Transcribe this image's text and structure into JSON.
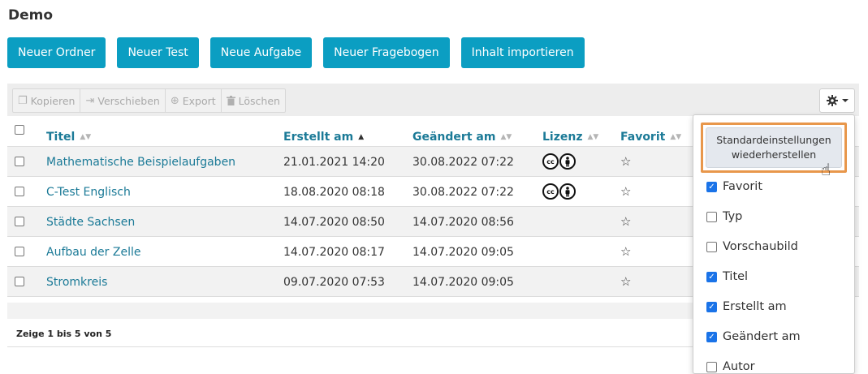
{
  "page": {
    "title": "Demo"
  },
  "actions": [
    "Neuer Ordner",
    "Neuer Test",
    "Neue Aufgabe",
    "Neuer Fragebogen",
    "Inhalt importieren"
  ],
  "toolbar": {
    "copy": "Kopieren",
    "move": "Verschieben",
    "export": "Export",
    "delete": "Löschen",
    "copy_icon": "copy-icon",
    "move_icon": "move-icon",
    "export_icon": "download-icon",
    "delete_icon": "trash-icon",
    "settings_icon": "gear-icon"
  },
  "table": {
    "headers": {
      "title": "Titel",
      "created": "Erstellt am",
      "modified": "Geändert am",
      "license": "Lizenz",
      "favorite": "Favorit"
    },
    "sorted_column": "created",
    "rows": [
      {
        "title": "Mathematische Beispielaufgaben",
        "created": "21.01.2021 14:20",
        "modified": "30.08.2022 07:22",
        "license": true
      },
      {
        "title": "C-Test Englisch",
        "created": "18.08.2020 08:18",
        "modified": "30.08.2022 07:22",
        "license": true
      },
      {
        "title": "Städte Sachsen",
        "created": "14.07.2020 08:50",
        "modified": "14.07.2020 08:56",
        "license": false
      },
      {
        "title": "Aufbau der Zelle",
        "created": "14.07.2020 08:17",
        "modified": "14.07.2020 09:05",
        "license": false
      },
      {
        "title": "Stromkreis",
        "created": "09.07.2020 07:53",
        "modified": "14.07.2020 09:05",
        "license": false
      }
    ]
  },
  "footer": {
    "summary": "Zeige 1 bis 5 von 5"
  },
  "column_menu": {
    "reset_line1": "Standardeinstellungen",
    "reset_line2": "wiederherstellen",
    "options": [
      {
        "label": "Favorit",
        "checked": true
      },
      {
        "label": "Typ",
        "checked": false
      },
      {
        "label": "Vorschaubild",
        "checked": false
      },
      {
        "label": "Titel",
        "checked": true
      },
      {
        "label": "Erstellt am",
        "checked": true
      },
      {
        "label": "Geändert am",
        "checked": true
      },
      {
        "label": "Autor",
        "checked": false
      }
    ]
  },
  "colors": {
    "primary": "#0b9ec2",
    "link": "#1b7a97",
    "highlight": "#e8974b",
    "checkbox": "#1a73e8"
  }
}
